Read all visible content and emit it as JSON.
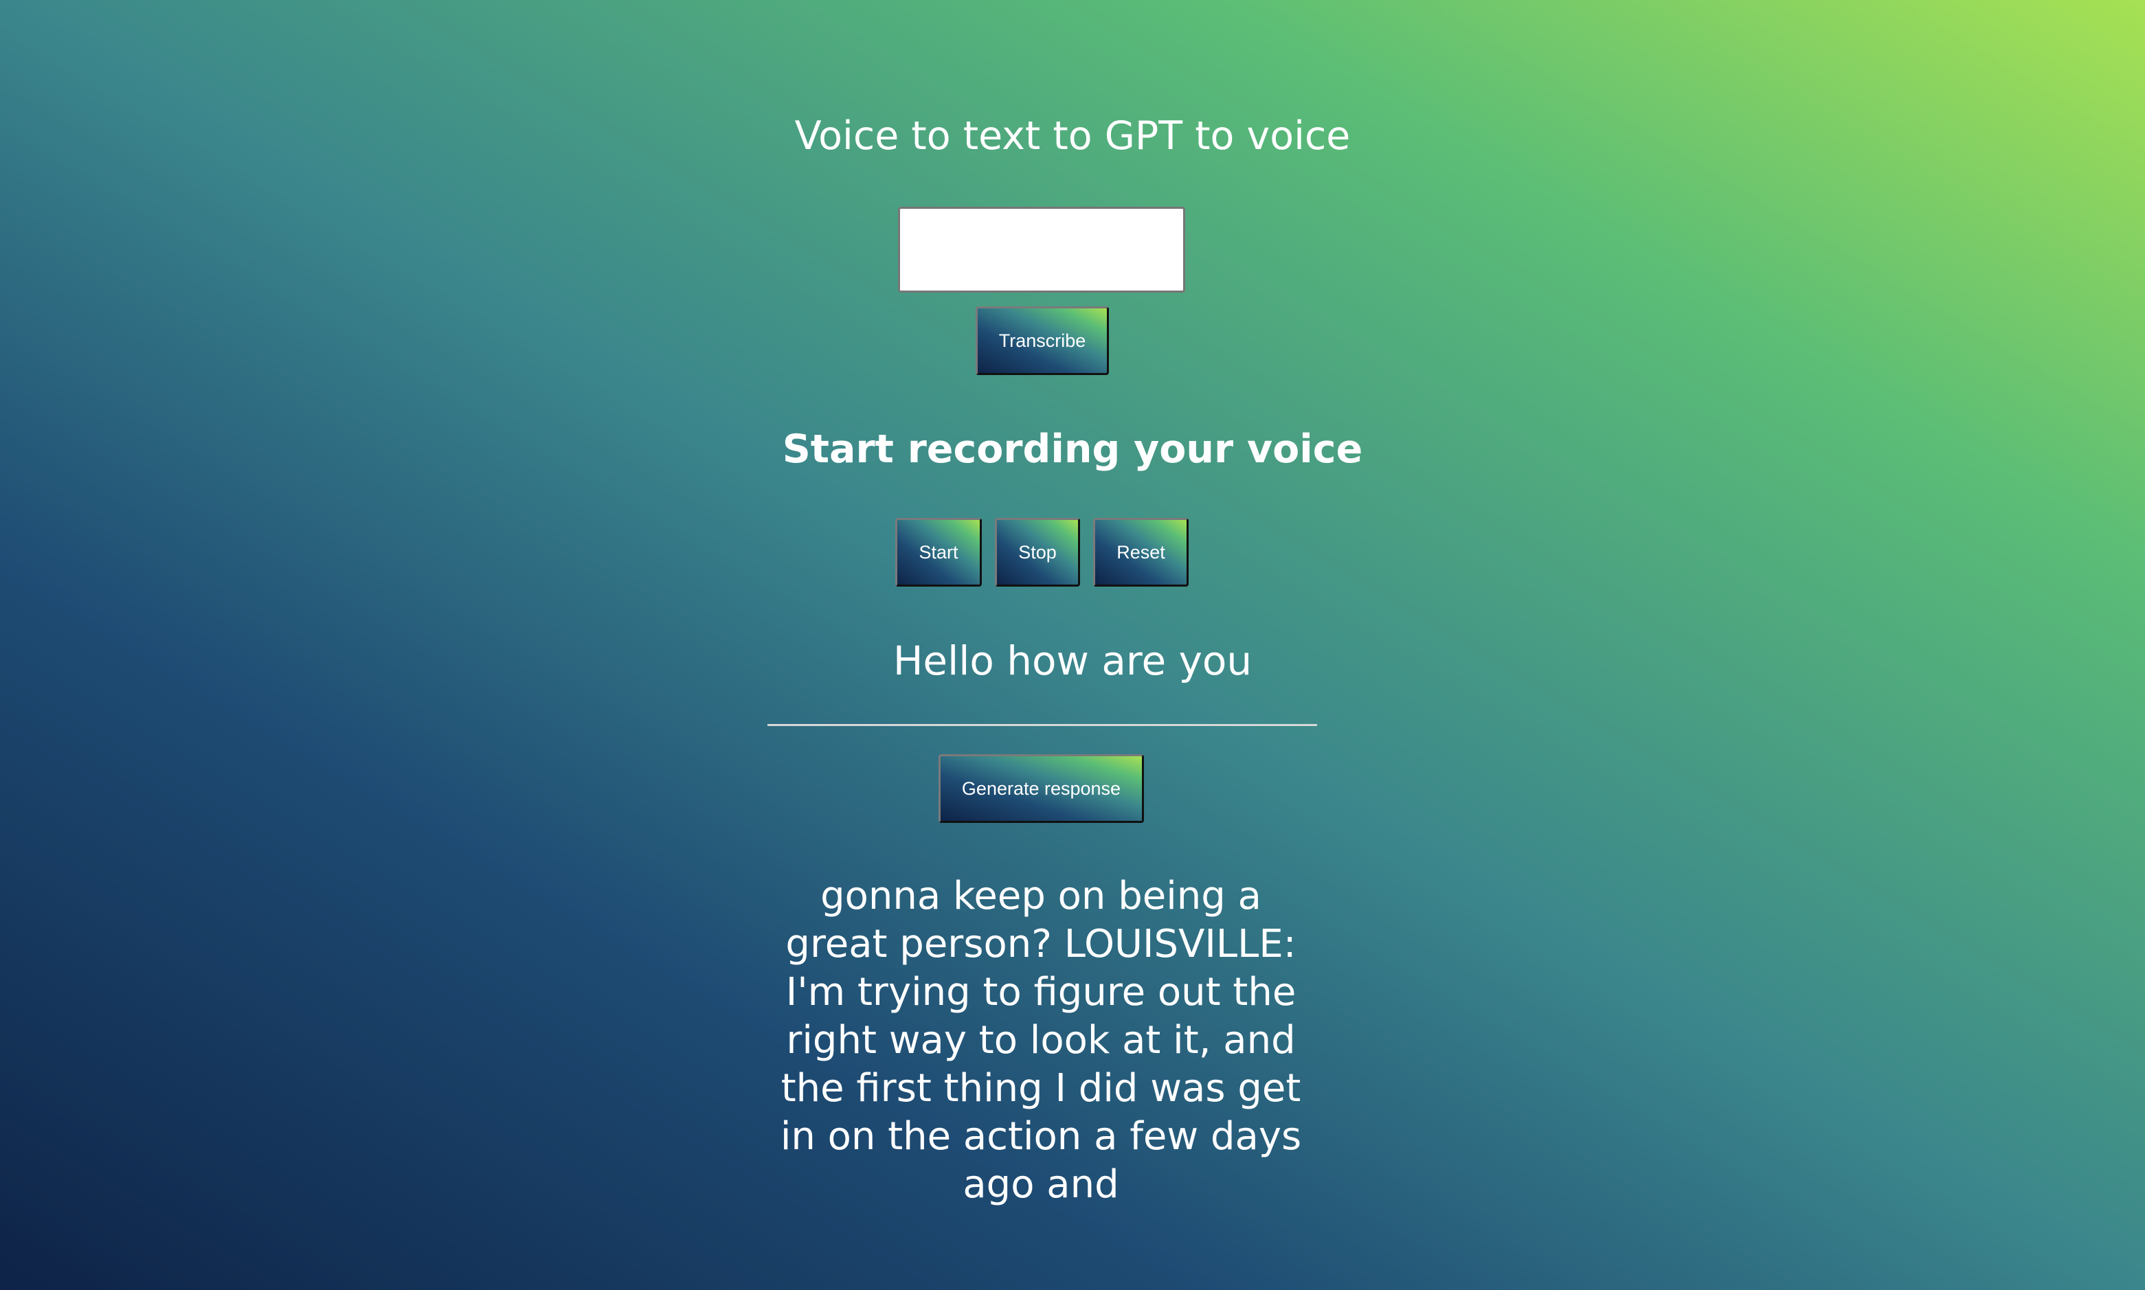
{
  "page": {
    "title": "Voice to text to GPT to voice"
  },
  "upload": {
    "transcribe_label": "Transcribe"
  },
  "recorder": {
    "heading": "Start recording your voice",
    "start_label": "Start",
    "stop_label": "Stop",
    "reset_label": "Reset"
  },
  "transcript": {
    "text": "Hello how are you"
  },
  "generate": {
    "label": "Generate response"
  },
  "response": {
    "text": "gonna keep on being a great person? LOUISVILLE: I'm trying to figure out the right way to look at it, and the first thing I did was get in on the action a few days ago and"
  },
  "colors": {
    "gradient_dark": "#0e2347",
    "gradient_mid": "#3b868c",
    "gradient_light": "#a7e153",
    "text": "#ffffff"
  }
}
